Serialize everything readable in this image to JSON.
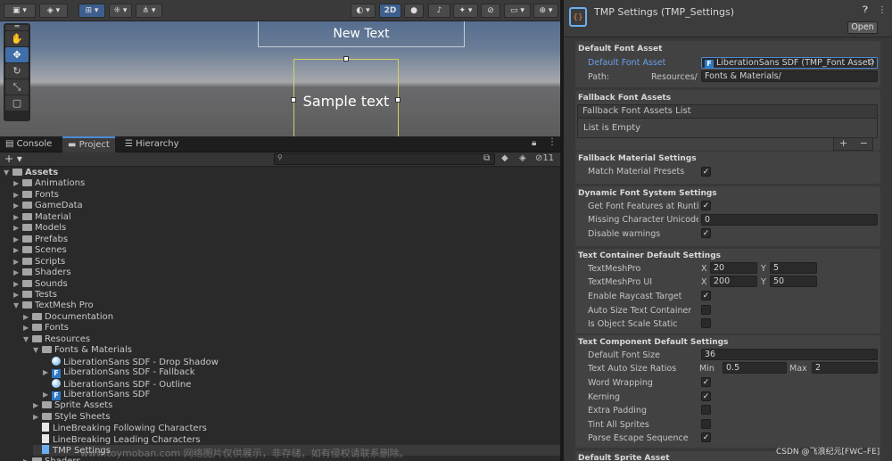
{
  "scene": {
    "toolbar": {
      "two_d": "2D"
    },
    "new_text": "New Text",
    "sample_text": "Sample text"
  },
  "panel_tabs": [
    "Console",
    "Project",
    "Hierarchy"
  ],
  "project": {
    "hidden_count": "11"
  },
  "tree": [
    {
      "label": "Assets",
      "indent": 0,
      "icon": "folder",
      "arrow": "open",
      "bold": true
    },
    {
      "label": "Animations",
      "indent": 1,
      "icon": "folder",
      "arrow": "closed"
    },
    {
      "label": "Fonts",
      "indent": 1,
      "icon": "folder",
      "arrow": "closed"
    },
    {
      "label": "GameData",
      "indent": 1,
      "icon": "folder",
      "arrow": "closed"
    },
    {
      "label": "Material",
      "indent": 1,
      "icon": "folder",
      "arrow": "closed"
    },
    {
      "label": "Models",
      "indent": 1,
      "icon": "folder",
      "arrow": "closed"
    },
    {
      "label": "Prefabs",
      "indent": 1,
      "icon": "folder",
      "arrow": "closed"
    },
    {
      "label": "Scenes",
      "indent": 1,
      "icon": "folder",
      "arrow": "closed"
    },
    {
      "label": "Scripts",
      "indent": 1,
      "icon": "folder",
      "arrow": "closed"
    },
    {
      "label": "Shaders",
      "indent": 1,
      "icon": "folder",
      "arrow": "closed"
    },
    {
      "label": "Sounds",
      "indent": 1,
      "icon": "folder",
      "arrow": "closed"
    },
    {
      "label": "Tests",
      "indent": 1,
      "icon": "folder",
      "arrow": "closed"
    },
    {
      "label": "TextMesh Pro",
      "indent": 1,
      "icon": "folder",
      "arrow": "open"
    },
    {
      "label": "Documentation",
      "indent": 2,
      "icon": "folder",
      "arrow": "closed"
    },
    {
      "label": "Fonts",
      "indent": 2,
      "icon": "folder",
      "arrow": "closed"
    },
    {
      "label": "Resources",
      "indent": 2,
      "icon": "folder",
      "arrow": "open"
    },
    {
      "label": "Fonts & Materials",
      "indent": 3,
      "icon": "folder",
      "arrow": "open"
    },
    {
      "label": "LiberationSans SDF - Drop Shadow",
      "indent": 4,
      "icon": "material",
      "arrow": "none"
    },
    {
      "label": "LiberationSans SDF - Fallback",
      "indent": 4,
      "icon": "font",
      "arrow": "closed"
    },
    {
      "label": "LiberationSans SDF - Outline",
      "indent": 4,
      "icon": "material",
      "arrow": "none"
    },
    {
      "label": "LiberationSans SDF",
      "indent": 4,
      "icon": "font",
      "arrow": "closed"
    },
    {
      "label": "Sprite Assets",
      "indent": 3,
      "icon": "folder",
      "arrow": "closed"
    },
    {
      "label": "Style Sheets",
      "indent": 3,
      "icon": "folder",
      "arrow": "closed"
    },
    {
      "label": "LineBreaking Following Characters",
      "indent": 3,
      "icon": "doc",
      "arrow": "none"
    },
    {
      "label": "LineBreaking Leading Characters",
      "indent": 3,
      "icon": "doc",
      "arrow": "none"
    },
    {
      "label": "TMP Settings",
      "indent": 3,
      "icon": "settings",
      "arrow": "none"
    },
    {
      "label": "Shaders",
      "indent": 2,
      "icon": "folder",
      "arrow": "closed"
    }
  ],
  "inspector": {
    "title": "TMP Settings (TMP_Settings)",
    "open_button": "Open",
    "default_font_asset": {
      "title": "Default Font Asset",
      "field_label": "Default Font Asset",
      "field_value": "LiberationSans SDF (TMP_Font Asset)",
      "path_label": "Path:",
      "path_prefix": "Resources/",
      "path_value": "Fonts & Materials/"
    },
    "fallback": {
      "title": "Fallback Font Assets",
      "list_header": "Fallback Font Assets List",
      "empty": "List is Empty",
      "add": "+",
      "remove": "−"
    },
    "fallback_material": {
      "title": "Fallback Material Settings",
      "match_label": "Match Material Presets",
      "match_checked": true
    },
    "dynamic": {
      "title": "Dynamic Font System Settings",
      "features_label": "Get Font Features at Runtin",
      "features_checked": true,
      "missing_label": "Missing Character Unicode",
      "missing_value": "0",
      "disable_label": "Disable warnings",
      "disable_checked": true
    },
    "container": {
      "title": "Text Container Default Settings",
      "tmp_label": "TextMeshPro",
      "tmp_x": "20",
      "tmp_y": "5",
      "tmpui_label": "TextMeshPro UI",
      "tmpui_x": "200",
      "tmpui_y": "50",
      "x": "X",
      "y": "Y",
      "raycast_label": "Enable Raycast Target",
      "raycast_checked": true,
      "autosize_label": "Auto Size Text Container",
      "autosize_checked": false,
      "static_label": "Is Object Scale Static",
      "static_checked": false
    },
    "component": {
      "title": "Text Component Default Settings",
      "fontsize_label": "Default Font Size",
      "fontsize_value": "36",
      "ratio_label": "Text Auto Size Ratios",
      "min_label": "Min",
      "min_value": "0.5",
      "max_label": "Max",
      "max_value": "2",
      "wrap_label": "Word Wrapping",
      "wrap_checked": true,
      "kerning_label": "Kerning",
      "kerning_checked": true,
      "padding_label": "Extra Padding",
      "padding_checked": false,
      "tint_label": "Tint All Sprites",
      "tint_checked": false,
      "escape_label": "Parse Escape Sequence",
      "escape_checked": true
    },
    "sprite": {
      "title": "Default Sprite Asset"
    }
  },
  "watermark": "CSDN @飞浪纪元[FWC–FE]",
  "overlay_text": "www.toymoban.com 网络图片仅供展示，非存储，如有侵权请联系删除。"
}
